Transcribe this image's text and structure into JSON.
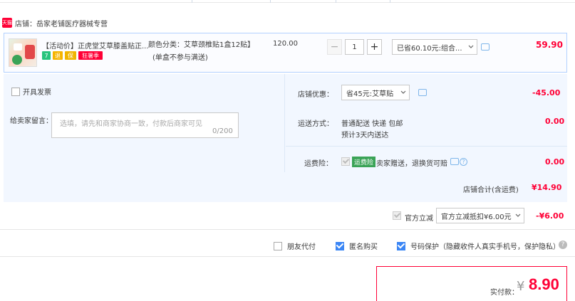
{
  "shop": {
    "name": "店铺：岳家老铺医疗器械专营",
    "badge": "天猫"
  },
  "item": {
    "title": "【活动价】正虎堂艾草膝盖贴正...",
    "badges": [
      "7",
      "退",
      "保",
      "狂暑季"
    ],
    "sku_line1": "颜色分类：艾草颈椎贴1盒12贴】",
    "sku_line2": "(单盒不参与满送)",
    "unit_price": "120.00",
    "quantity": "1",
    "minus": "−",
    "plus": "+",
    "promo_option": "已省60.10元:组合...",
    "subtotal": "59.90"
  },
  "invoice": {
    "label": "开具发票"
  },
  "message": {
    "label": "给卖家留言：",
    "placeholder": "选填，请先和商家协商一致，付款后商家可见",
    "counter": "0/200"
  },
  "shop_discount": {
    "label": "店铺优惠：",
    "option": "省45元:艾草贴",
    "value": "-45.00"
  },
  "shipping": {
    "label": "运送方式：",
    "line1": "普通配送 快递 包邮",
    "line2": "预计3天内送达",
    "value": "0.00"
  },
  "insurance": {
    "label": "运费险：",
    "tag": "运费险",
    "text": "卖家赠送，退换货可赔",
    "value": "0.00"
  },
  "shop_total": {
    "label": "店铺合计(含运费)",
    "value": "¥14.90"
  },
  "official_discount": {
    "label": "官方立减",
    "option": "官方立减抵扣¥6.00元",
    "value": "-¥6.00"
  },
  "options": {
    "friend_pay": "朋友代付",
    "anonymous": "匿名购买",
    "number_protect": "号码保护（隐藏收件人真实手机号，保护隐私）"
  },
  "pay": {
    "label": "实付款：",
    "currency": "¥",
    "amount": "8.90"
  },
  "colors": {
    "accent": "#ff0036",
    "blue": "#3b86f5",
    "section_bg": "#f2f7ff"
  }
}
